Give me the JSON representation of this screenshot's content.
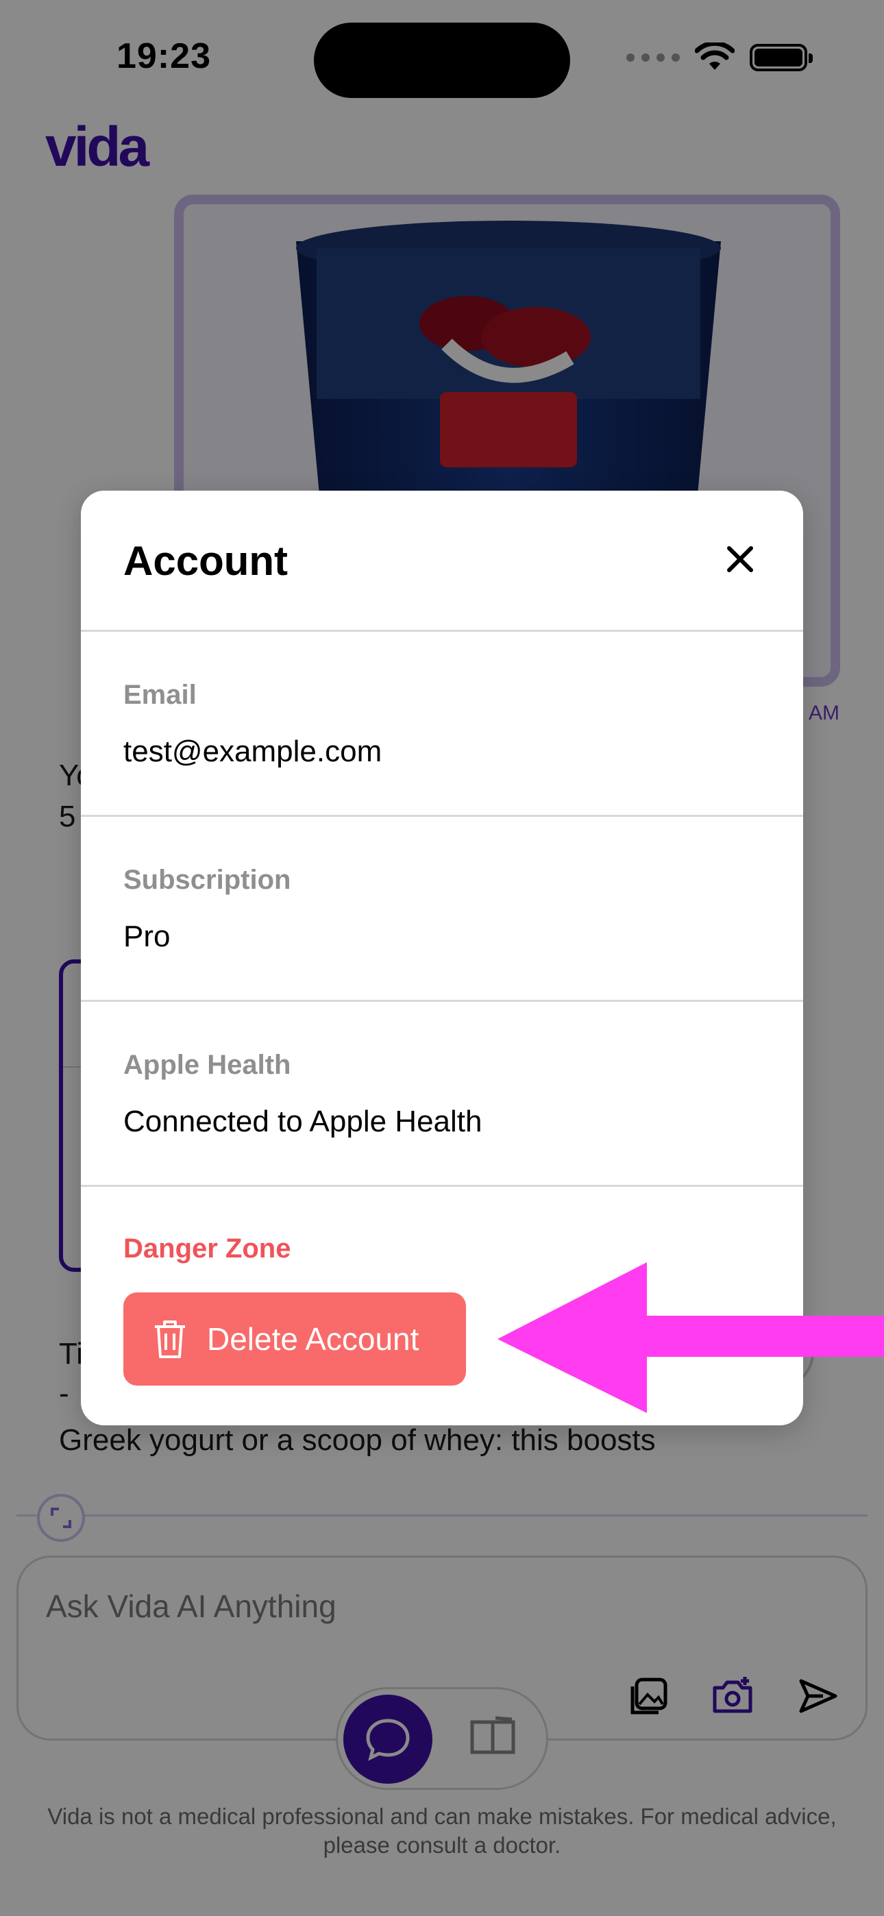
{
  "status_bar": {
    "time": "19:23"
  },
  "app": {
    "logo_text": "vida"
  },
  "chat": {
    "message_time": "AM",
    "reply_line1": "Yo",
    "reply_line2": "5",
    "tip_line1": "Ti",
    "tip_line2": "-",
    "tip_line3": "Greek yogurt or a scoop of whey: this boosts"
  },
  "composer": {
    "placeholder": "Ask Vida AI Anything",
    "icons": [
      "gallery-icon",
      "camera-add-icon",
      "send-icon"
    ]
  },
  "mode_toggle": {
    "active": "chat",
    "icons": [
      "chat-bubble-icon",
      "book-icon"
    ]
  },
  "disclaimer": "Vida is not a medical professional and can make mistakes. For medical advice, please consult a doctor.",
  "account_modal": {
    "title": "Account",
    "sections": [
      {
        "label": "Email",
        "value": "test@example.com"
      },
      {
        "label": "Subscription",
        "value": "Pro"
      },
      {
        "label": "Apple Health",
        "value": "Connected to Apple Health"
      }
    ],
    "danger_zone": {
      "label": "Danger Zone",
      "delete_button": "Delete Account"
    }
  },
  "colors": {
    "brand": "#3f0fa8",
    "danger": "#f0535a",
    "delete_button": "#f96a6a",
    "annotation_arrow": "#ff3cf0"
  }
}
